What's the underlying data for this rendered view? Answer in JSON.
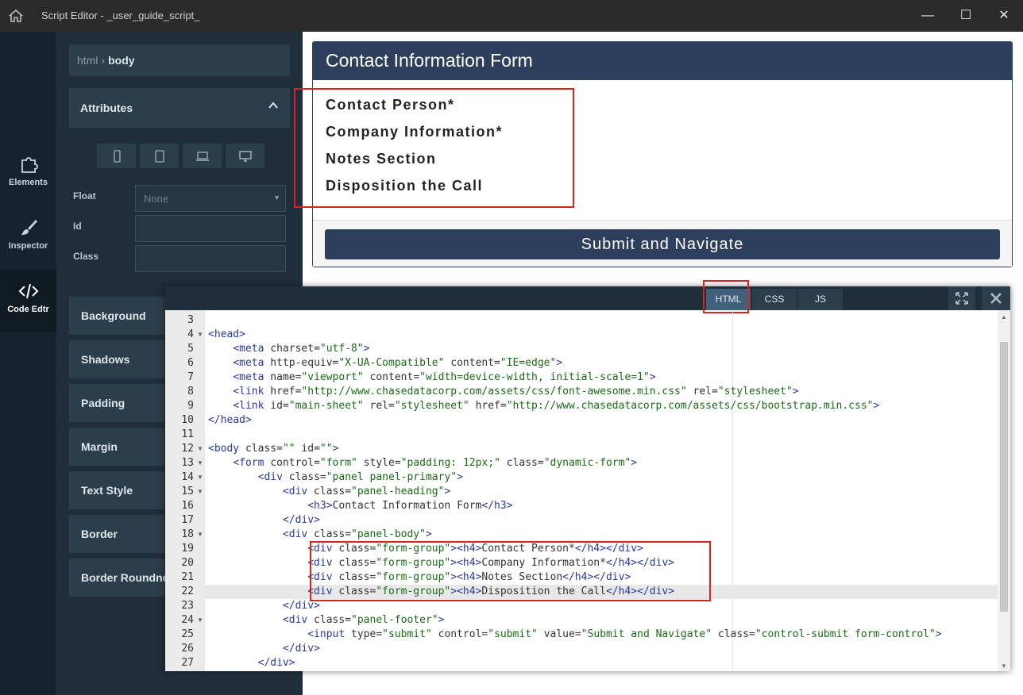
{
  "window": {
    "title": "Script Editor - _user_guide_script_",
    "minimize": "—",
    "maximize": "☐",
    "close": "✕"
  },
  "nav": {
    "items": [
      {
        "label": "Elements",
        "icon": "puzzle-icon"
      },
      {
        "label": "Inspector",
        "icon": "brush-icon"
      },
      {
        "label": "Code Edtr",
        "icon": "code-icon"
      }
    ]
  },
  "inspector": {
    "breadcrumb": [
      "html",
      "body"
    ],
    "attributes_title": "Attributes",
    "devices": [
      "mobile-icon",
      "tablet-icon",
      "laptop-icon",
      "desktop-icon"
    ],
    "float_label": "Float",
    "float_value": "None",
    "id_label": "Id",
    "id_value": "",
    "class_label": "Class",
    "class_value": "",
    "sections": [
      "Background",
      "Shadows",
      "Padding",
      "Margin",
      "Text Style",
      "Border",
      "Border Roundness"
    ]
  },
  "preview": {
    "heading": "Contact Information Form",
    "form_groups": [
      "Contact Person*",
      "Company Information*",
      "Notes Section",
      "Disposition the Call"
    ],
    "submit_label": "Submit and Navigate"
  },
  "editor": {
    "tabs": [
      "HTML",
      "CSS",
      "JS"
    ],
    "active_tab": "HTML",
    "current_line": 22,
    "lines": [
      {
        "n": 3,
        "text": ""
      },
      {
        "n": 4,
        "text": "<head>"
      },
      {
        "n": 5,
        "text": "    <meta charset=\"utf-8\">"
      },
      {
        "n": 6,
        "text": "    <meta http-equiv=\"X-UA-Compatible\" content=\"IE=edge\">"
      },
      {
        "n": 7,
        "text": "    <meta name=\"viewport\" content=\"width=device-width, initial-scale=1\">"
      },
      {
        "n": 8,
        "text": "    <link href=\"http://www.chasedatacorp.com/assets/css/font-awesome.min.css\" rel=\"stylesheet\">"
      },
      {
        "n": 9,
        "text": "    <link id=\"main-sheet\" rel=\"stylesheet\" href=\"http://www.chasedatacorp.com/assets/css/bootstrap.min.css\">"
      },
      {
        "n": 10,
        "text": "</head>"
      },
      {
        "n": 11,
        "text": ""
      },
      {
        "n": 12,
        "text": "<body class=\"\" id=\"\">"
      },
      {
        "n": 13,
        "text": "    <form control=\"form\" style=\"padding: 12px;\" class=\"dynamic-form\">"
      },
      {
        "n": 14,
        "text": "        <div class=\"panel panel-primary\">"
      },
      {
        "n": 15,
        "text": "            <div class=\"panel-heading\">"
      },
      {
        "n": 16,
        "text": "                <h3>Contact Information Form</h3>"
      },
      {
        "n": 17,
        "text": "            </div>"
      },
      {
        "n": 18,
        "text": "            <div class=\"panel-body\">"
      },
      {
        "n": 19,
        "text": "                <div class=\"form-group\"><h4>Contact Person*</h4></div>"
      },
      {
        "n": 20,
        "text": "                <div class=\"form-group\"><h4>Company Information*</h4></div>"
      },
      {
        "n": 21,
        "text": "                <div class=\"form-group\"><h4>Notes Section</h4></div>"
      },
      {
        "n": 22,
        "text": "                <div class=\"form-group\"><h4>Disposition the Call</h4></div>"
      },
      {
        "n": 23,
        "text": "            </div>"
      },
      {
        "n": 24,
        "text": "            <div class=\"panel-footer\">"
      },
      {
        "n": 25,
        "text": "                <input type=\"submit\" control=\"submit\" value=\"Submit and Navigate\" class=\"control-submit form-control\">"
      },
      {
        "n": 26,
        "text": "            </div>"
      },
      {
        "n": 27,
        "text": "        </div>"
      }
    ],
    "fold_lines": [
      4,
      12,
      13,
      14,
      15,
      18,
      24
    ]
  }
}
